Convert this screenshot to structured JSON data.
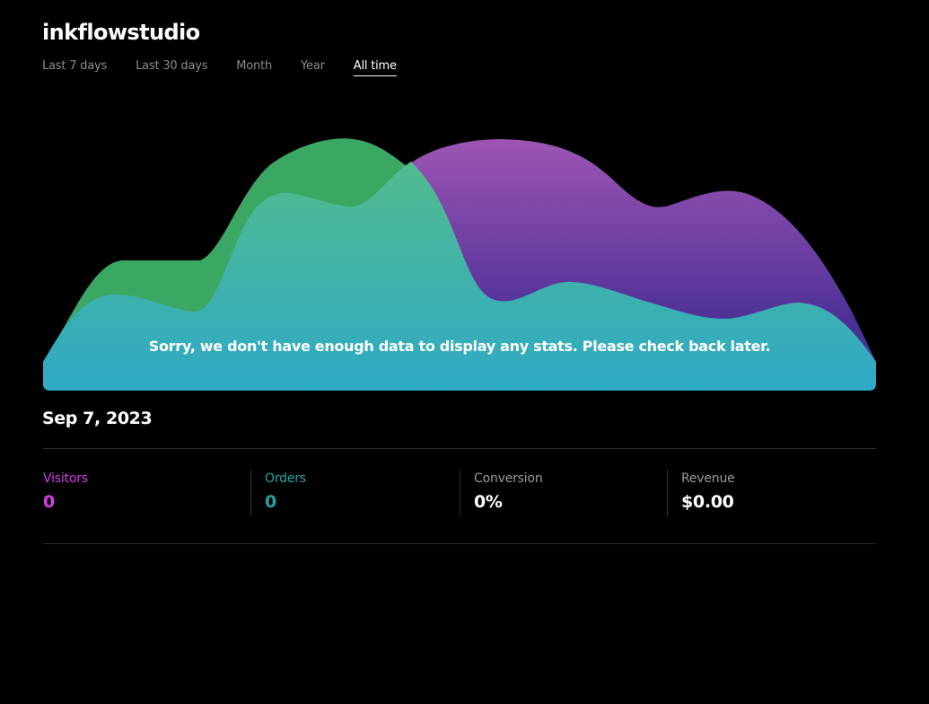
{
  "store": {
    "name": "inkflowstudio"
  },
  "range_tabs": [
    {
      "label": "Last 7 days",
      "active": false
    },
    {
      "label": "Last 30 days",
      "active": false
    },
    {
      "label": "Month",
      "active": false
    },
    {
      "label": "Year",
      "active": false
    },
    {
      "label": "All time",
      "active": true
    }
  ],
  "chart": {
    "empty_message": "Sorry, we don't have enough data to display any stats. Please check back later.",
    "colors": {
      "green": "#3aa862",
      "purple_top": "#9e55b3",
      "purple_bottom": "#4a2f96",
      "teal_top": "#52bb8e",
      "teal_bottom": "#2ea9c6"
    }
  },
  "summary": {
    "date": "Sep 7, 2023",
    "stats": [
      {
        "key": "visitors",
        "label": "Visitors",
        "value": "0",
        "color": "#d63ee8"
      },
      {
        "key": "orders",
        "label": "Orders",
        "value": "0",
        "color": "#26a3a3"
      },
      {
        "key": "conversion",
        "label": "Conversion",
        "value": "0%",
        "color": "#9a9a9a"
      },
      {
        "key": "revenue",
        "label": "Revenue",
        "value": "$0.00",
        "color": "#9a9a9a"
      }
    ]
  }
}
